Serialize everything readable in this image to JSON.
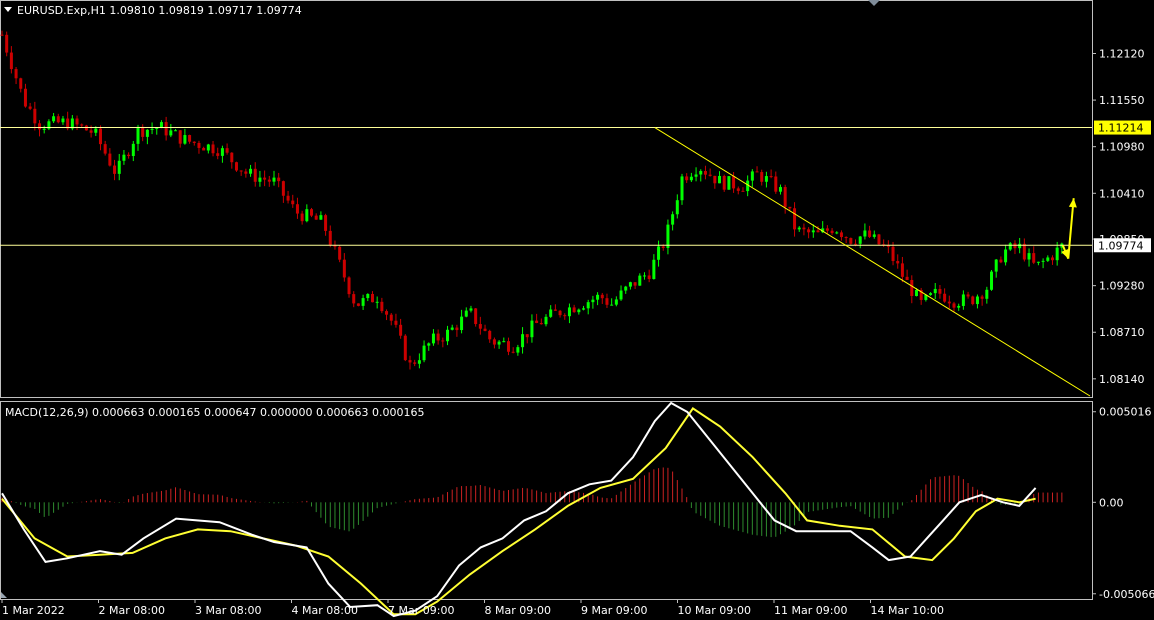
{
  "header": {
    "symbol_line": "EURUSD.Exp,H1  1.09810 1.09819 1.09717 1.09774",
    "macd_line": "MACD(12,26,9) 0.000663 0.000165 0.000647 0.000000 0.000663 0.000165"
  },
  "colors": {
    "background": "#000000",
    "bull": "#00ff00",
    "bear": "#cc0000",
    "level_line": "#ffff99",
    "trend_line": "#ffff00",
    "arrow": "#ffff00",
    "macd_line": "#ffffff",
    "signal_line": "#ffff33",
    "hist_pos": "#cc2222",
    "hist_neg": "#2e8b2e",
    "axis_text": "#ffffff",
    "frame": "#c0c0c0"
  },
  "chart_data": [
    {
      "type": "candlestick",
      "title": "EURUSD.Exp,H1",
      "ylim": [
        1.0793,
        1.1275
      ],
      "y_ticks": [
        "1.12120",
        "1.11550",
        "1.10980",
        "1.10410",
        "1.09850",
        "1.09280",
        "1.08710",
        "1.08140"
      ],
      "x_ticks": [
        "1 Mar 2022",
        "2 Mar 08:00",
        "3 Mar 08:00",
        "4 Mar 08:00",
        "7 Mar 09:00",
        "8 Mar 09:00",
        "9 Mar 09:00",
        "10 Mar 09:00",
        "11 Mar 09:00",
        "14 Mar 10:00"
      ],
      "price_labels": {
        "level_high": "1.11214",
        "current": "1.09774"
      },
      "levels": [
        1.11214,
        1.09774
      ],
      "trendline": {
        "from": {
          "bar": 0.6,
          "price": 1.11214
        },
        "to": {
          "bar": 1.0,
          "price": 1.0793
        }
      },
      "arrows": [
        {
          "from": {
            "bar": 0.975,
            "price": 1.09774
          },
          "to": {
            "bar": 0.98,
            "price": 1.0961
          }
        },
        {
          "from": {
            "bar": 0.98,
            "price": 1.0961
          },
          "to": {
            "bar": 0.985,
            "price": 1.1035
          }
        }
      ],
      "path_anchors": [
        [
          0,
          1.1235
        ],
        [
          0.02,
          1.1155
        ],
        [
          0.035,
          1.1125
        ],
        [
          0.06,
          1.1128
        ],
        [
          0.085,
          1.1115
        ],
        [
          0.105,
          1.1065
        ],
        [
          0.125,
          1.1118
        ],
        [
          0.145,
          1.1122
        ],
        [
          0.17,
          1.1105
        ],
        [
          0.2,
          1.1095
        ],
        [
          0.225,
          1.1065
        ],
        [
          0.25,
          1.1055
        ],
        [
          0.27,
          1.1018
        ],
        [
          0.295,
          1.1005
        ],
        [
          0.31,
          1.0955
        ],
        [
          0.325,
          1.0905
        ],
        [
          0.345,
          1.0915
        ],
        [
          0.36,
          1.088
        ],
        [
          0.375,
          1.083
        ],
        [
          0.395,
          1.086
        ],
        [
          0.41,
          1.087
        ],
        [
          0.43,
          1.0895
        ],
        [
          0.45,
          1.086
        ],
        [
          0.47,
          1.0855
        ],
        [
          0.49,
          1.088
        ],
        [
          0.51,
          1.0895
        ],
        [
          0.53,
          1.0905
        ],
        [
          0.55,
          1.0915
        ],
        [
          0.56,
          1.0905
        ],
        [
          0.575,
          1.0925
        ],
        [
          0.595,
          1.0945
        ],
        [
          0.61,
          1.0985
        ],
        [
          0.625,
          1.106
        ],
        [
          0.64,
          1.1075
        ],
        [
          0.66,
          1.1055
        ],
        [
          0.68,
          1.105
        ],
        [
          0.695,
          1.1065
        ],
        [
          0.715,
          1.1045
        ],
        [
          0.73,
          1.0995
        ],
        [
          0.75,
          1.099
        ],
        [
          0.765,
          1.1
        ],
        [
          0.78,
          1.0985
        ],
        [
          0.795,
          1.099
        ],
        [
          0.815,
          1.097
        ],
        [
          0.83,
          1.0935
        ],
        [
          0.845,
          1.0905
        ],
        [
          0.86,
          1.092
        ],
        [
          0.875,
          1.091
        ],
        [
          0.89,
          1.091
        ],
        [
          0.905,
          1.0925
        ],
        [
          0.92,
          1.097
        ],
        [
          0.935,
          1.0975
        ],
        [
          0.95,
          1.095
        ],
        [
          0.965,
          1.0965
        ],
        [
          0.975,
          1.0977
        ]
      ]
    },
    {
      "type": "line",
      "title": "MACD(12,26,9)",
      "ylim": [
        -0.0053,
        0.0055
      ],
      "y_ticks": [
        "0.005016",
        "0.00",
        "-0.005066"
      ],
      "series": [
        {
          "role": "macd",
          "points": [
            [
              0,
              0.0005
            ],
            [
              0.02,
              -0.0015
            ],
            [
              0.04,
              -0.0033
            ],
            [
              0.06,
              -0.0031
            ],
            [
              0.09,
              -0.0027
            ],
            [
              0.11,
              -0.0029
            ],
            [
              0.13,
              -0.002
            ],
            [
              0.16,
              -0.0009
            ],
            [
              0.2,
              -0.0011
            ],
            [
              0.23,
              -0.0018
            ],
            [
              0.25,
              -0.0022
            ],
            [
              0.28,
              -0.0025
            ],
            [
              0.3,
              -0.0045
            ],
            [
              0.32,
              -0.0058
            ],
            [
              0.345,
              -0.0057
            ],
            [
              0.36,
              -0.0063
            ],
            [
              0.38,
              -0.006
            ],
            [
              0.4,
              -0.0052
            ],
            [
              0.42,
              -0.0035
            ],
            [
              0.44,
              -0.0025
            ],
            [
              0.46,
              -0.002
            ],
            [
              0.48,
              -0.001
            ],
            [
              0.5,
              -0.0005
            ],
            [
              0.52,
              0.0005
            ],
            [
              0.54,
              0.001
            ],
            [
              0.56,
              0.0012
            ],
            [
              0.58,
              0.0025
            ],
            [
              0.6,
              0.0045
            ],
            [
              0.615,
              0.0055
            ],
            [
              0.63,
              0.005
            ],
            [
              0.65,
              0.0035
            ],
            [
              0.67,
              0.002
            ],
            [
              0.69,
              0.0005
            ],
            [
              0.71,
              -0.001
            ],
            [
              0.73,
              -0.0016
            ],
            [
              0.76,
              -0.0016
            ],
            [
              0.78,
              -0.0016
            ],
            [
              0.8,
              -0.0025
            ],
            [
              0.815,
              -0.0032
            ],
            [
              0.835,
              -0.003
            ],
            [
              0.85,
              -0.002
            ],
            [
              0.865,
              -0.001
            ],
            [
              0.88,
              0.0
            ],
            [
              0.9,
              0.0004
            ],
            [
              0.92,
              0.0
            ],
            [
              0.935,
              -0.0002
            ],
            [
              0.95,
              0.0008
            ]
          ]
        },
        {
          "role": "signal",
          "points": [
            [
              0,
              0.0002
            ],
            [
              0.03,
              -0.002
            ],
            [
              0.06,
              -0.003
            ],
            [
              0.09,
              -0.0029
            ],
            [
              0.12,
              -0.0028
            ],
            [
              0.15,
              -0.002
            ],
            [
              0.18,
              -0.0015
            ],
            [
              0.21,
              -0.0016
            ],
            [
              0.24,
              -0.002
            ],
            [
              0.27,
              -0.0024
            ],
            [
              0.3,
              -0.003
            ],
            [
              0.33,
              -0.0045
            ],
            [
              0.36,
              -0.0062
            ],
            [
              0.38,
              -0.0062
            ],
            [
              0.4,
              -0.0055
            ],
            [
              0.43,
              -0.004
            ],
            [
              0.46,
              -0.0027
            ],
            [
              0.49,
              -0.0015
            ],
            [
              0.52,
              -0.0002
            ],
            [
              0.55,
              0.0008
            ],
            [
              0.58,
              0.0013
            ],
            [
              0.61,
              0.003
            ],
            [
              0.635,
              0.0052
            ],
            [
              0.66,
              0.0042
            ],
            [
              0.69,
              0.0025
            ],
            [
              0.72,
              0.0005
            ],
            [
              0.74,
              -0.001
            ],
            [
              0.77,
              -0.0013
            ],
            [
              0.8,
              -0.0015
            ],
            [
              0.83,
              -0.003
            ],
            [
              0.855,
              -0.0032
            ],
            [
              0.875,
              -0.002
            ],
            [
              0.895,
              -0.0005
            ],
            [
              0.915,
              0.0002
            ],
            [
              0.935,
              0.0
            ],
            [
              0.95,
              0.0002
            ]
          ]
        }
      ]
    }
  ]
}
